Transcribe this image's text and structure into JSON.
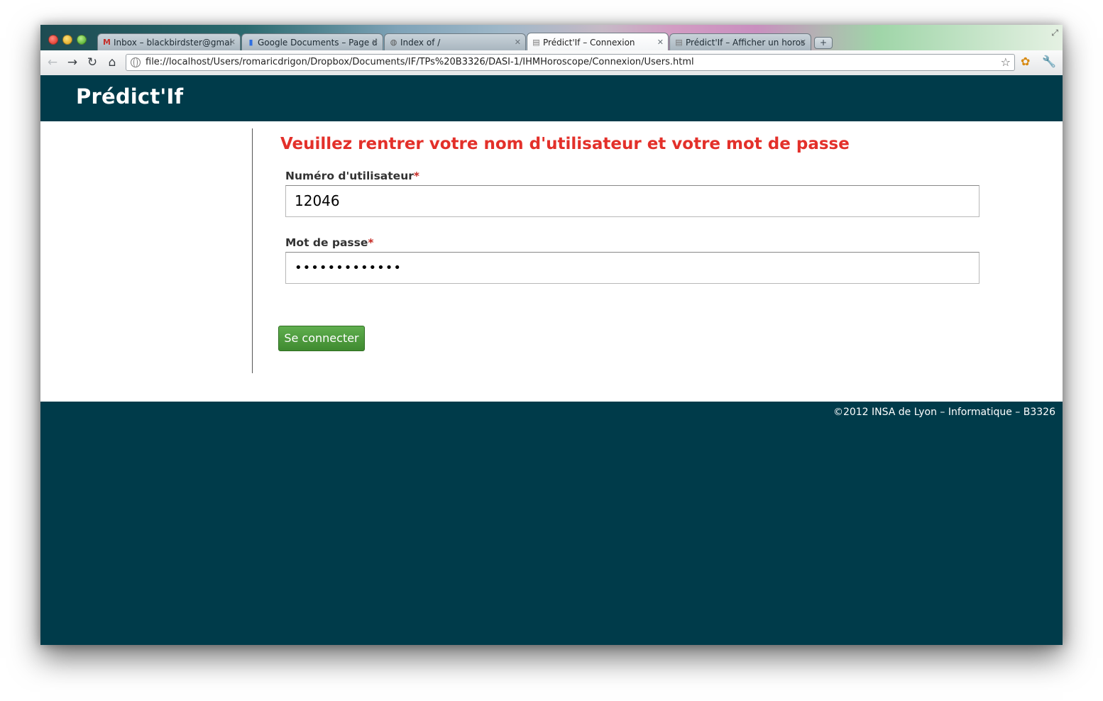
{
  "browser": {
    "tabs": [
      {
        "title": "Inbox – blackbirdster@gmai",
        "favicon": "gmail-icon",
        "active": false
      },
      {
        "title": "Google Documents – Page d",
        "favicon": "google-docs-icon",
        "active": false
      },
      {
        "title": "Index of /",
        "favicon": "globe-icon",
        "active": false
      },
      {
        "title": "Prédict'If – Connexion",
        "favicon": "page-icon",
        "active": true
      },
      {
        "title": "Prédict'If – Afficher un horos",
        "favicon": "page-icon",
        "active": false
      }
    ],
    "new_tab_label": "+",
    "url": "file://localhost/Users/romaricdrigon/Dropbox/Documents/IF/TPs%20B3326/DASI-1/IHMHoroscope/Connexion/Users.html"
  },
  "header": {
    "brand": "Prédict'If"
  },
  "form": {
    "title": "Veuillez rentrer votre nom d'utilisateur et votre mot de passe",
    "user_label": "Numéro d'utilisateur",
    "user_value": "12046",
    "password_label": "Mot de passe",
    "password_value": "•••••••••••••",
    "required_mark": "*",
    "submit_label": "Se connecter"
  },
  "footer": {
    "copyright": "©2012 INSA de Lyon – Informatique – B3326"
  },
  "colors": {
    "brand_bg": "#003b4a",
    "title_red": "#e3302a",
    "button_green": "#4f9c3f"
  }
}
